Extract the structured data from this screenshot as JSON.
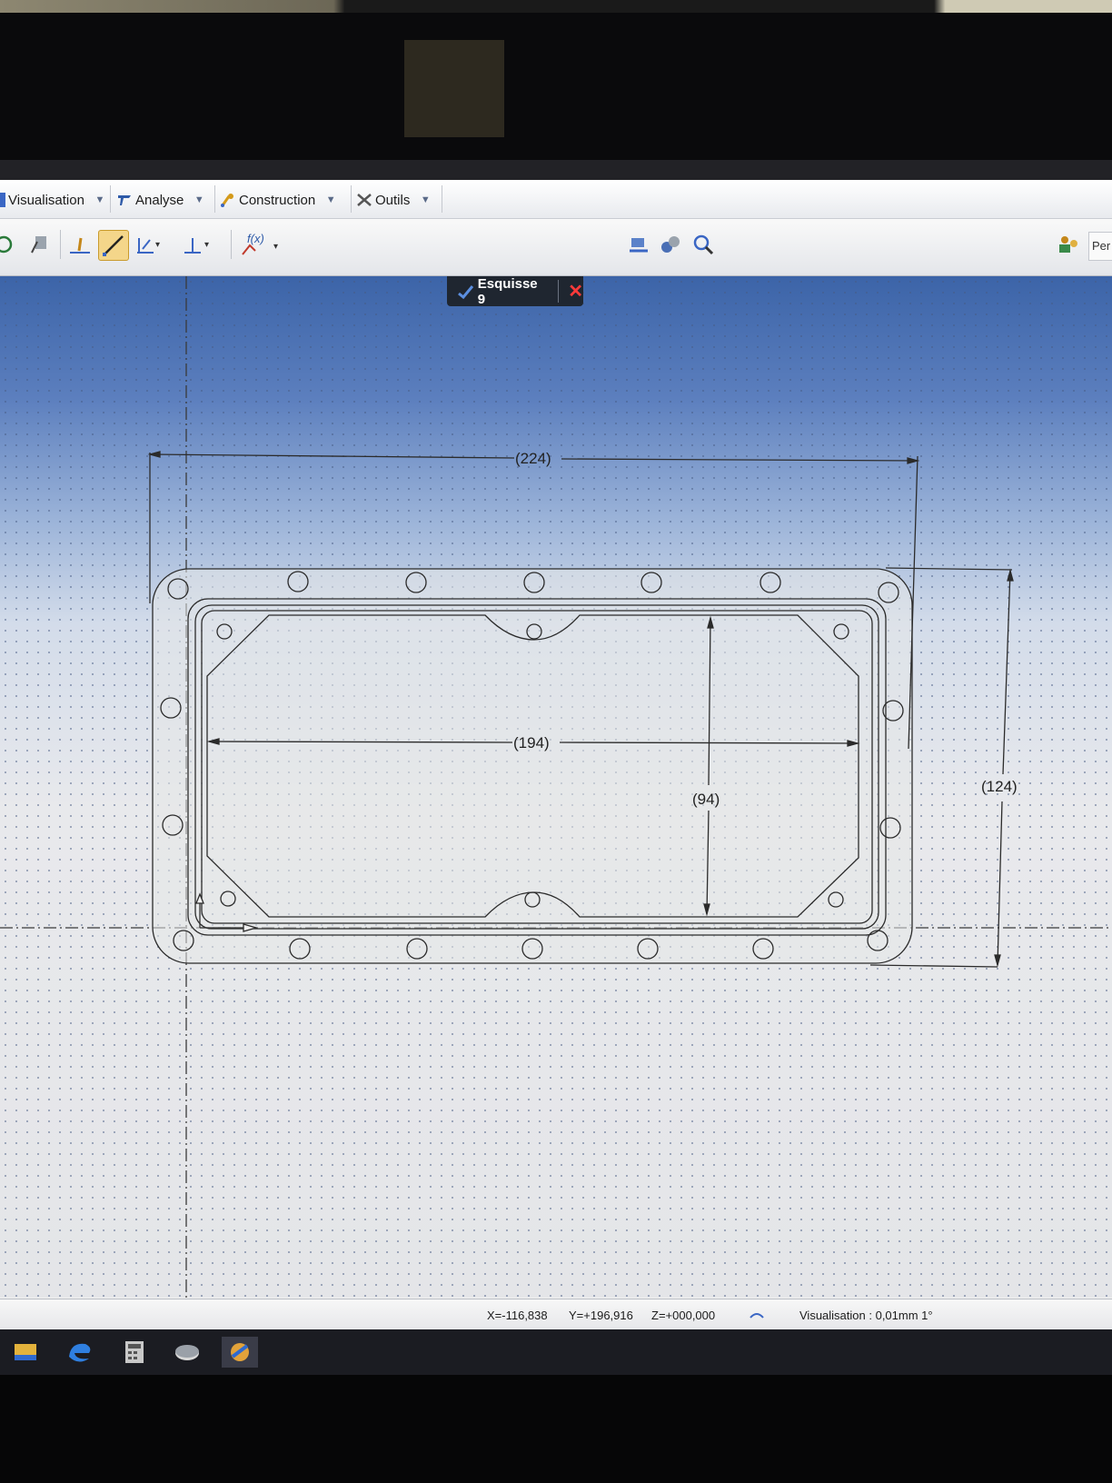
{
  "menu": {
    "items": [
      {
        "label": "Visualisation",
        "icon": "visualisation-icon"
      },
      {
        "label": "Analyse",
        "icon": "analyse-icon"
      },
      {
        "label": "Construction",
        "icon": "construction-icon"
      },
      {
        "label": "Outils",
        "icon": "outils-icon"
      }
    ]
  },
  "toolbar": {
    "formula_label": "f(x)",
    "right_panel_label": "Per"
  },
  "sketch": {
    "title": "Esquisse 9",
    "close_symbol": "✕"
  },
  "dimensions": {
    "overall_width": "(224)",
    "inner_width": "(194)",
    "inner_height": "(94)",
    "overall_height": "(124)"
  },
  "status": {
    "x": "X=-116,838",
    "y": "Y=+196,916",
    "z": "Z=+000,000",
    "view": "Visualisation : 0,01mm 1°"
  },
  "colors": {
    "accent_active": "#f4d68a",
    "close_red": "#ff3a3a",
    "viewport_top": "#3c64a8",
    "sketch_line": "#2b2b2b"
  }
}
